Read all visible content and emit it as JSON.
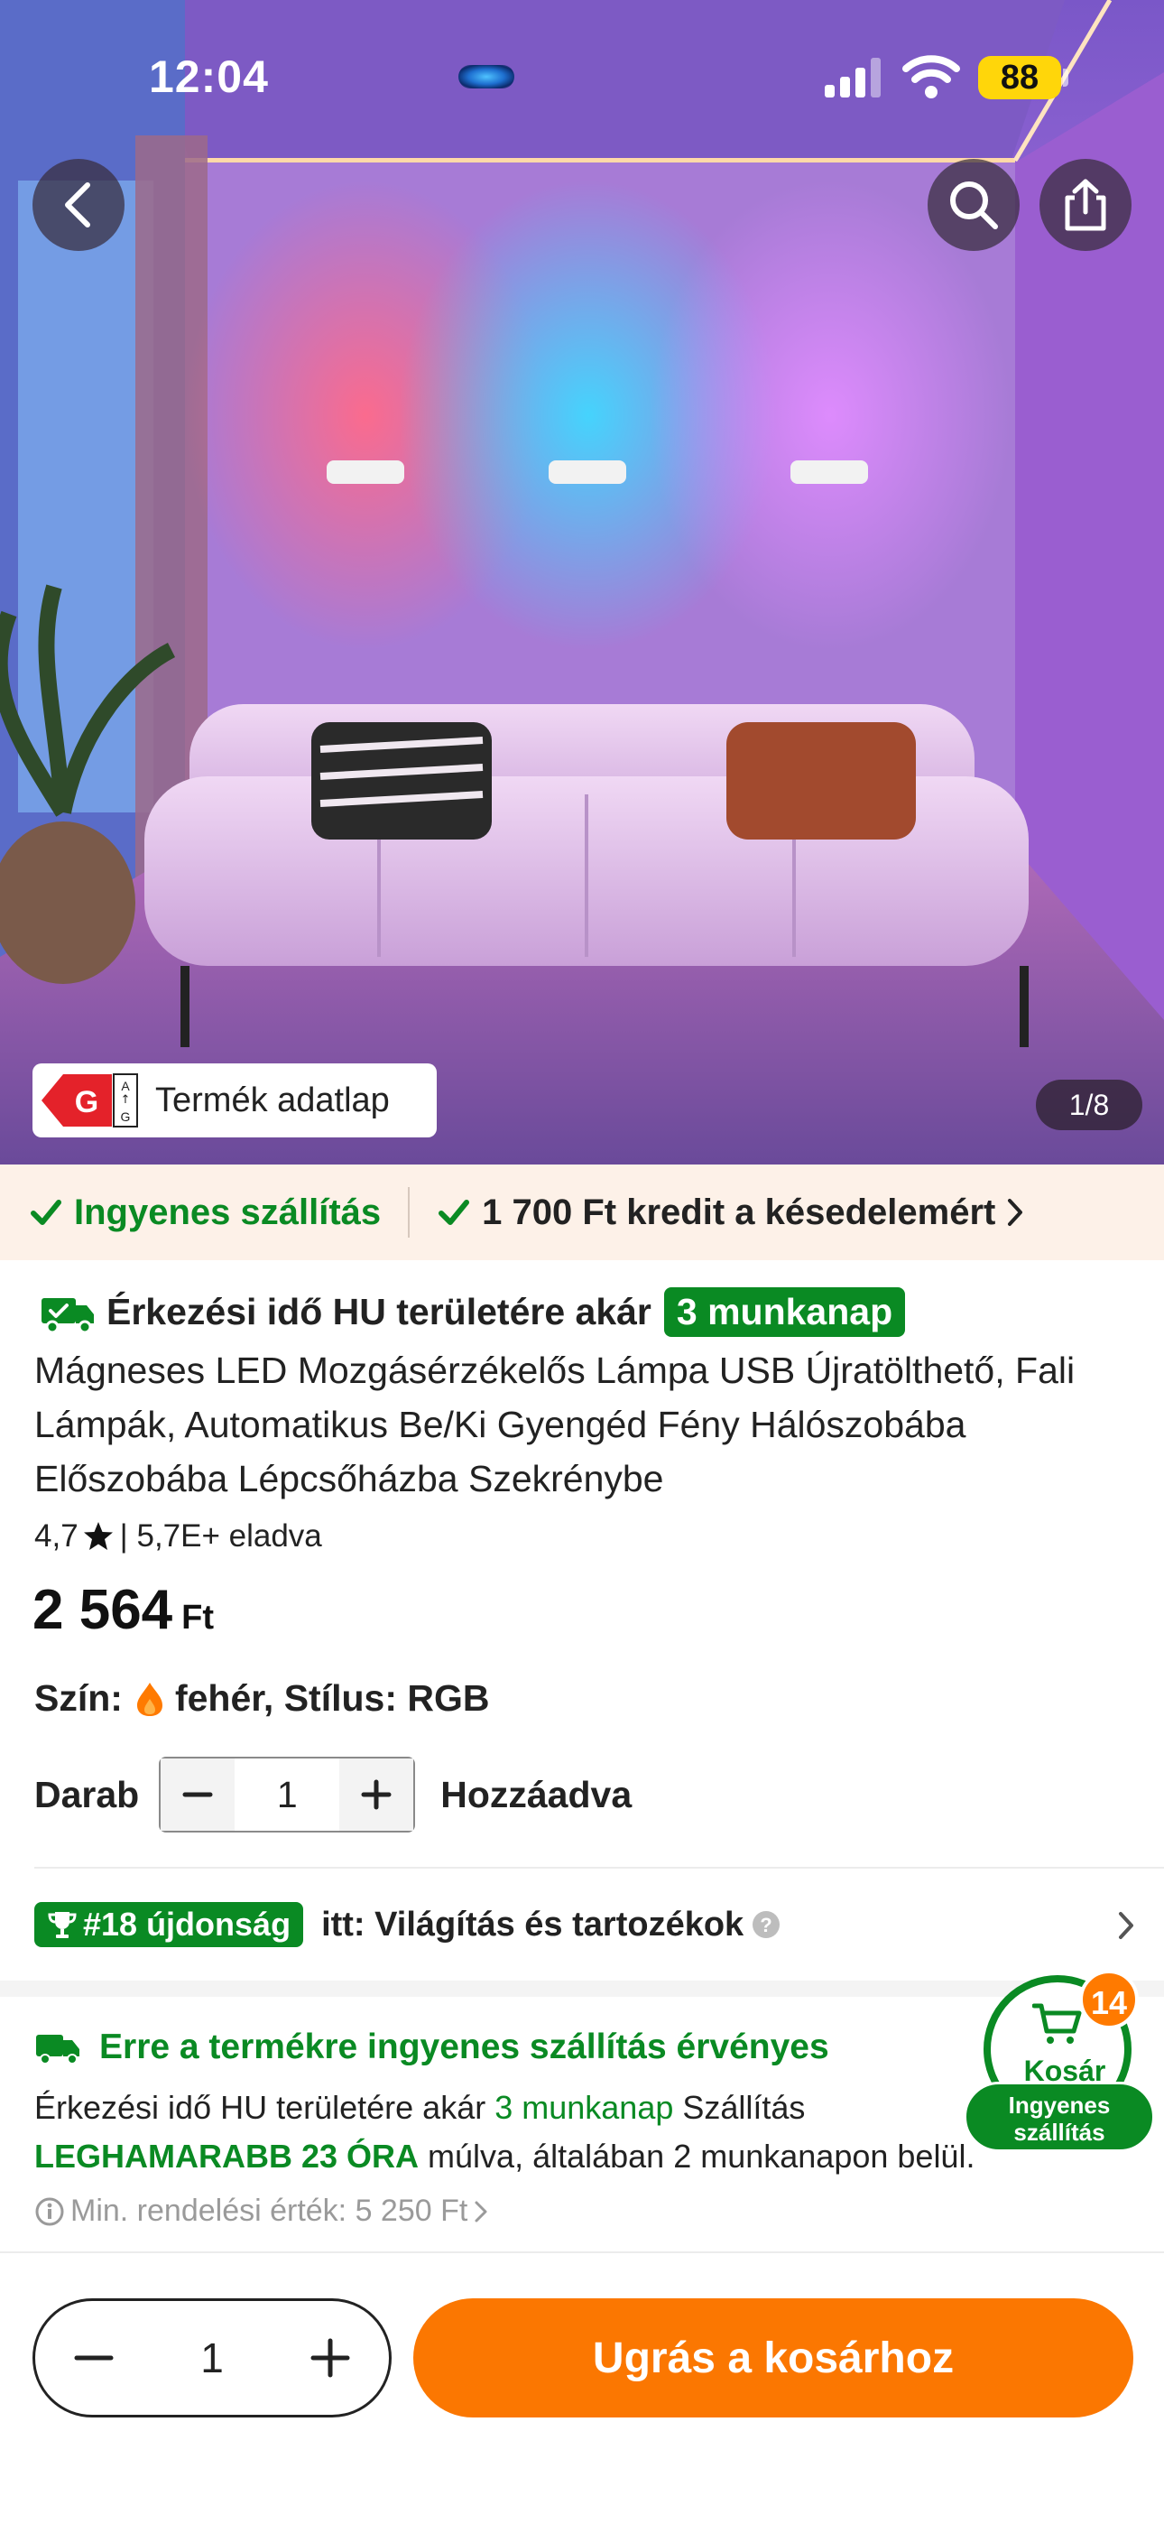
{
  "status_bar": {
    "time": "12:04",
    "battery": "88"
  },
  "hero": {
    "energy_label": {
      "class_letter": "G",
      "scale_top": "A",
      "scale_bottom": "G",
      "text": "Termék adatlap"
    },
    "image_counter": "1/8"
  },
  "promo": {
    "free_shipping": "Ingyenes szállítás",
    "credit": "1 700 Ft kredit a késedelemért"
  },
  "product": {
    "arrival_prefix": "Érkezési idő HU területére akár",
    "arrival_badge": "3 munkanap",
    "title": "Mágneses LED Mozgásérzékelős Lámpa USB Újratölthető, Fali Lámpák, Automatikus Be/Ki Gyengéd Fény Hálószobába Előszobába Lépcsőházba Szekrénybe",
    "rating": "4,7",
    "sold": "| 5,7E+ eladva",
    "price": "2 564",
    "currency": "Ft",
    "variant_label": "Szín:",
    "variant_value": "fehér, Stílus: RGB",
    "qty_label": "Darab",
    "qty_value": "1",
    "added_label": "Hozzáadva"
  },
  "ranking": {
    "badge": "#18 újdonság",
    "text": "itt: Világítás és tartozékok"
  },
  "shipping": {
    "title": "Erre a termékre ingyenes szállítás érvényes",
    "line_prefix": "Érkezési idő HU területére akár",
    "line_days": "3 munkanap",
    "line_mid": "Szállítás",
    "line_fast": "LEGHAMARABB 23 ÓRA",
    "line_suffix": "múlva, általában 2 munkanapon belül.",
    "min_order": "Min. rendelési érték: 5 250 Ft"
  },
  "cart_float": {
    "count": "14",
    "label": "Kosár",
    "ship_line1": "Ingyenes",
    "ship_line2": "szállítás"
  },
  "bottom_bar": {
    "qty_value": "1",
    "cta_label": "Ugrás a kosárhoz"
  },
  "colors": {
    "brand_green": "#0a8a23",
    "cta_orange": "#fb7701",
    "badge_orange": "#ff7a00",
    "promo_bg": "#fdf1e8"
  },
  "icons": [
    "back-arrow-icon",
    "search-icon",
    "share-icon",
    "check-icon",
    "chevron-right-icon",
    "truck-icon",
    "star-icon",
    "flame-icon",
    "minus-icon",
    "plus-icon",
    "trophy-icon",
    "help-icon",
    "info-icon",
    "cart-icon",
    "signal-icon",
    "wifi-icon"
  ]
}
